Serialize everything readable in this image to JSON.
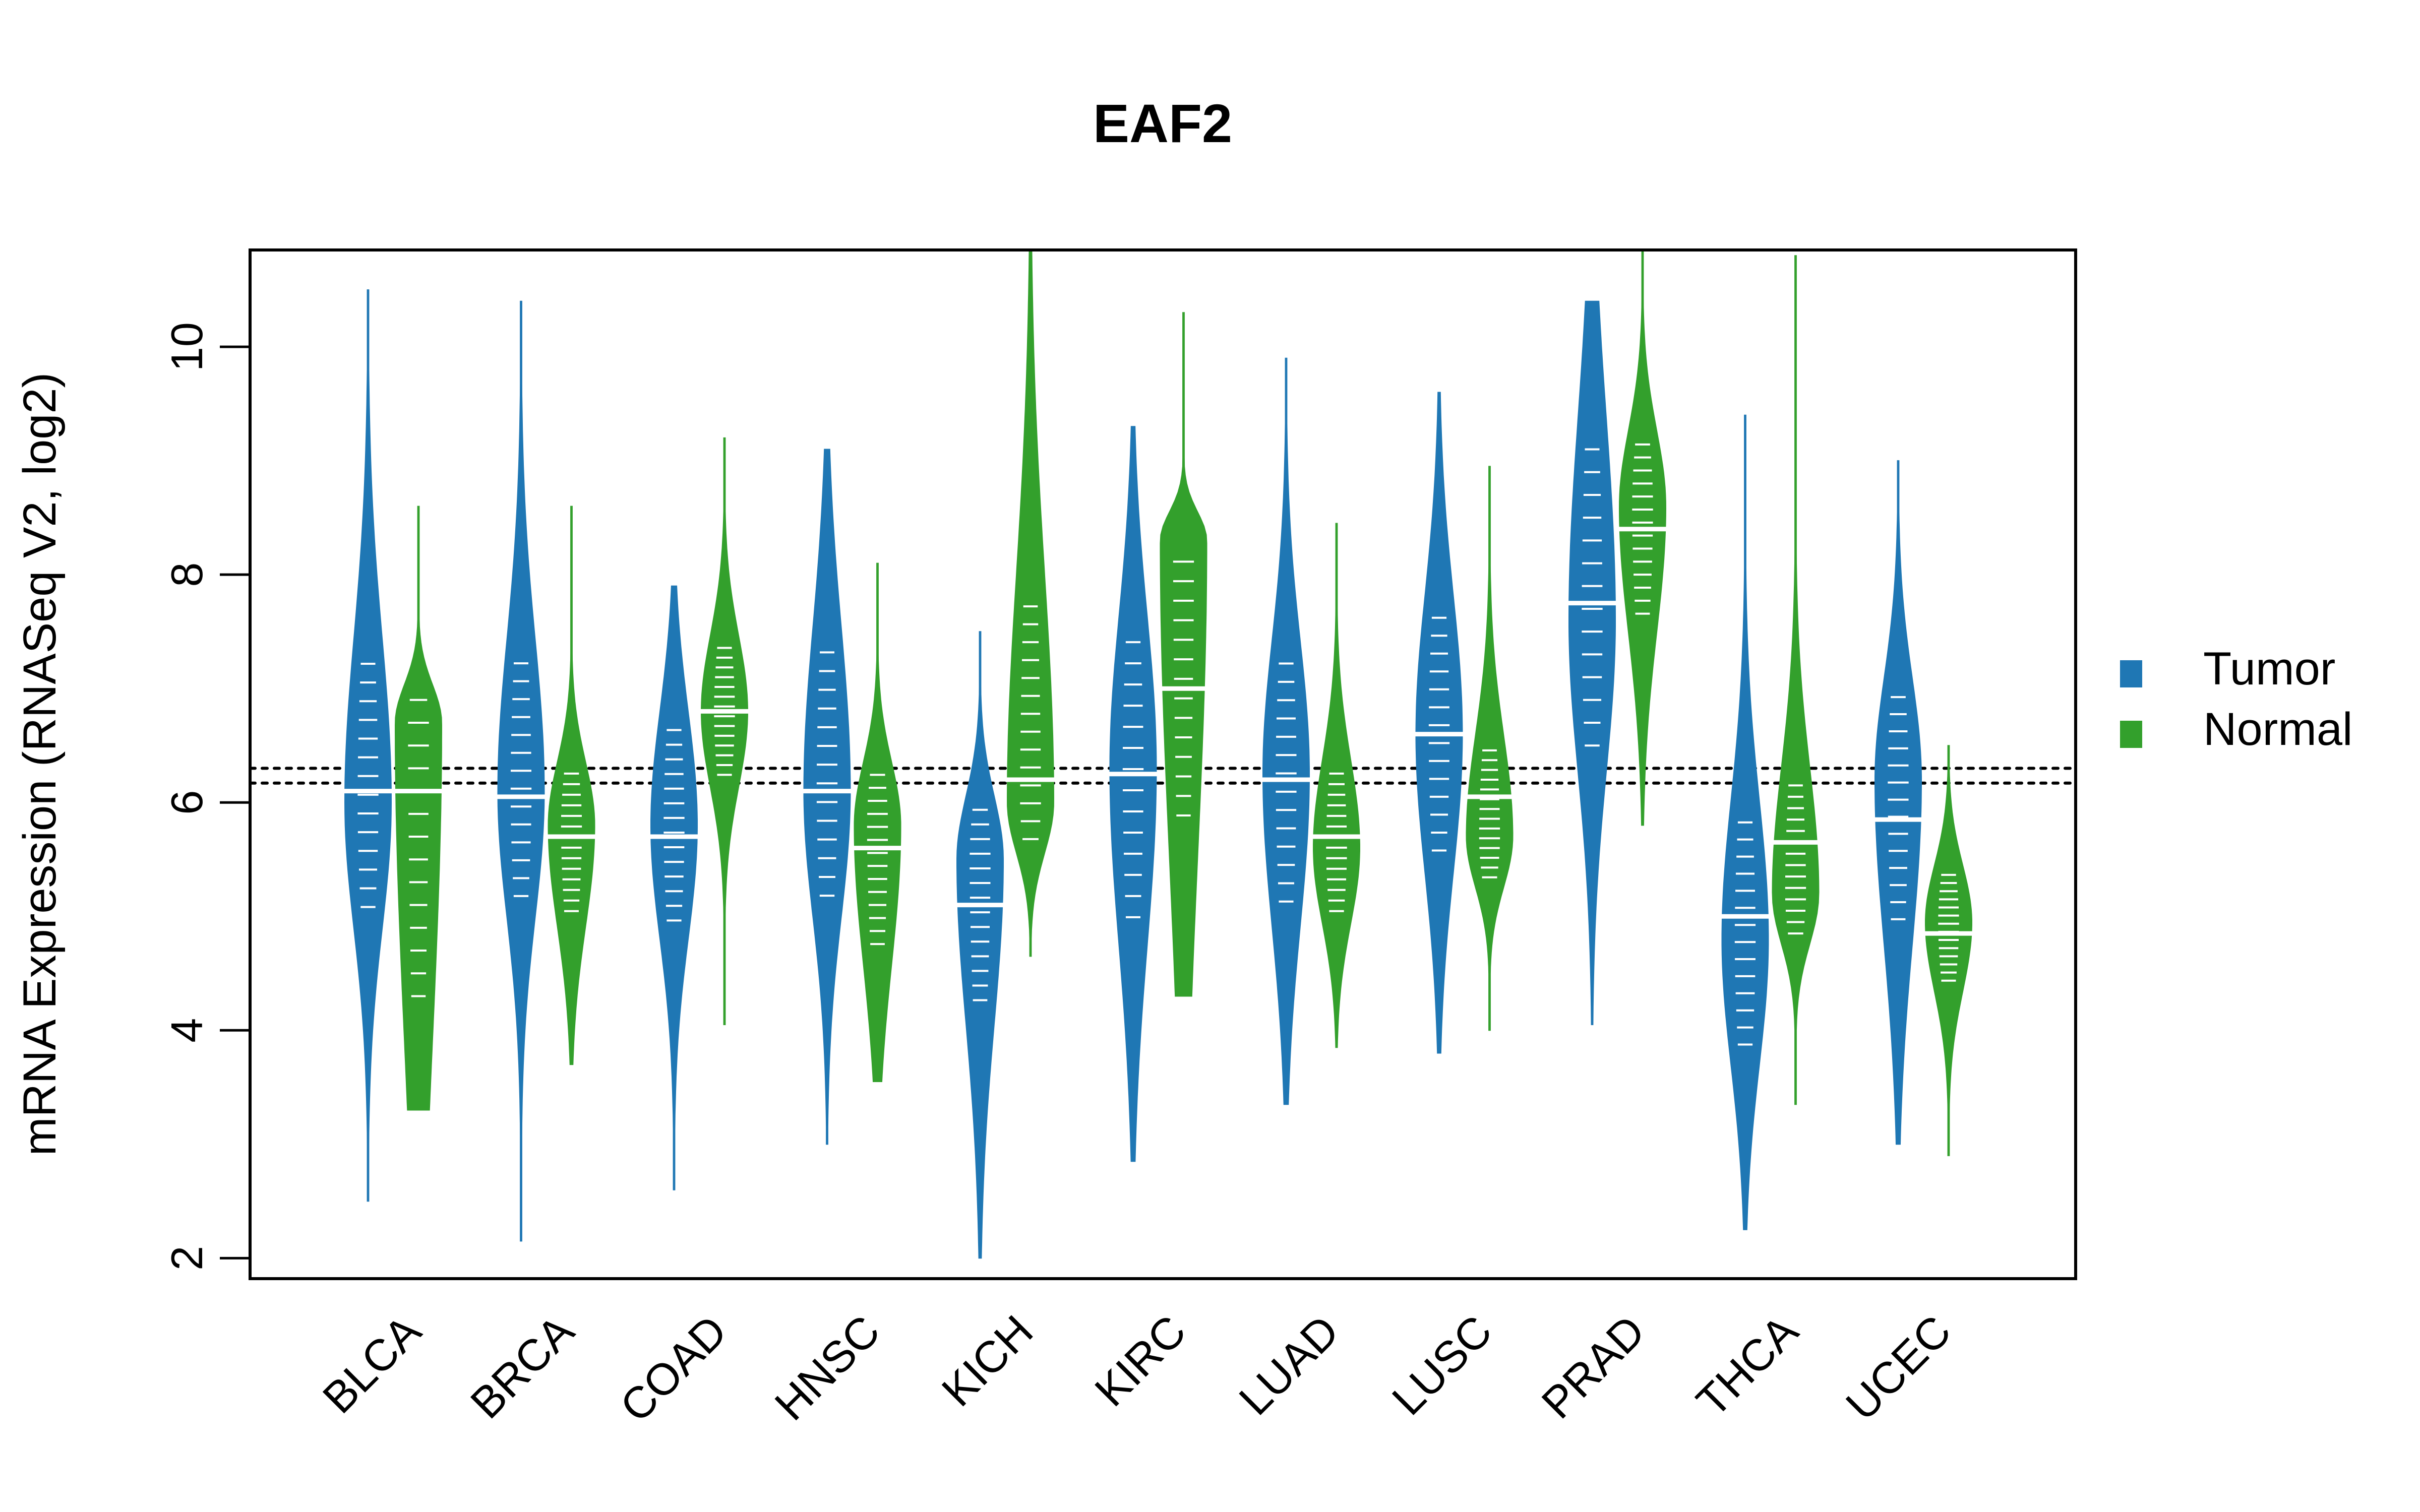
{
  "chart_data": {
    "type": "violin",
    "title": "EAF2",
    "xlabel": "",
    "ylabel": "mRNA Expression (RNASeq V2, log2)",
    "ylim": [
      1.82,
      10.85
    ],
    "yticks": [
      2,
      4,
      6,
      8,
      10
    ],
    "ytick_labels": [
      "2",
      "4",
      "6",
      "8",
      "10"
    ],
    "categories": [
      "BLCA",
      "BRCA",
      "COAD",
      "HNSC",
      "KICH",
      "KIRC",
      "LUAD",
      "LUSC",
      "PRAD",
      "THCA",
      "UCEC"
    ],
    "reference_lines": [
      6.3,
      6.17
    ],
    "reference_line_style": "dotted",
    "legend": {
      "position": "right",
      "entries": [
        {
          "label": "Tumor",
          "color": "#1f77b4"
        },
        {
          "label": "Normal",
          "color": "#33a02c"
        }
      ]
    },
    "series": [
      {
        "name": "Tumor",
        "color": "#1f77b4",
        "groups": [
          {
            "category": "BLCA",
            "min": 2.5,
            "max": 10.5,
            "median": 6.1,
            "q1": 5.0,
            "q3": 7.3,
            "peak": 6.0
          },
          {
            "category": "BRCA",
            "min": 2.15,
            "max": 10.4,
            "median": 6.05,
            "q1": 5.1,
            "q3": 7.3,
            "peak": 6.1
          },
          {
            "category": "COAD",
            "min": 2.6,
            "max": 7.9,
            "median": 5.7,
            "q1": 4.9,
            "q3": 6.7,
            "peak": 5.8
          },
          {
            "category": "HNSC",
            "min": 3.0,
            "max": 9.1,
            "median": 6.1,
            "q1": 5.1,
            "q3": 7.4,
            "peak": 6.1
          },
          {
            "category": "KICH",
            "min": 2.0,
            "max": 7.5,
            "median": 5.1,
            "q1": 4.2,
            "q3": 6.0,
            "peak": 5.5
          },
          {
            "category": "KIRC",
            "min": 2.85,
            "max": 9.3,
            "median": 6.25,
            "q1": 4.9,
            "q3": 7.5,
            "peak": 6.3
          },
          {
            "category": "LUAD",
            "min": 3.35,
            "max": 9.9,
            "median": 6.2,
            "q1": 5.05,
            "q3": 7.3,
            "peak": 6.25
          },
          {
            "category": "LUSC",
            "min": 3.8,
            "max": 9.6,
            "median": 6.6,
            "q1": 5.5,
            "q3": 7.7,
            "peak": 6.6
          },
          {
            "category": "PRAD",
            "min": 4.05,
            "max": 10.4,
            "median": 7.75,
            "q1": 6.4,
            "q3": 9.2,
            "peak": 7.6
          },
          {
            "category": "THCA",
            "min": 2.25,
            "max": 9.4,
            "median": 5.0,
            "q1": 3.8,
            "q3": 5.9,
            "peak": 4.8
          },
          {
            "category": "UCEC",
            "min": 3.0,
            "max": 9.0,
            "median": 5.85,
            "q1": 4.9,
            "q3": 7.0,
            "peak": 6.2
          }
        ]
      },
      {
        "name": "Normal",
        "color": "#33a02c",
        "groups": [
          {
            "category": "BLCA",
            "min": 3.3,
            "max": 8.6,
            "median": 6.1,
            "q1": 4.2,
            "q3": 7.0,
            "peak": 6.7
          },
          {
            "category": "BRCA",
            "min": 3.7,
            "max": 8.6,
            "median": 5.7,
            "q1": 5.0,
            "q3": 6.3,
            "peak": 5.8
          },
          {
            "category": "COAD",
            "min": 4.05,
            "max": 9.2,
            "median": 6.8,
            "q1": 6.2,
            "q3": 7.4,
            "peak": 6.8
          },
          {
            "category": "HNSC",
            "min": 3.55,
            "max": 8.1,
            "median": 5.6,
            "q1": 4.7,
            "q3": 6.3,
            "peak": 5.8
          },
          {
            "category": "KICH",
            "min": 4.65,
            "max": 10.85,
            "median": 6.2,
            "q1": 5.6,
            "q3": 7.8,
            "peak": 6.0
          },
          {
            "category": "KIRC",
            "min": 4.3,
            "max": 10.3,
            "median": 7.0,
            "q1": 5.8,
            "q3": 8.2,
            "peak": 8.3
          },
          {
            "category": "LUAD",
            "min": 3.85,
            "max": 8.45,
            "median": 5.7,
            "q1": 5.0,
            "q3": 6.3,
            "peak": 5.6
          },
          {
            "category": "LUSC",
            "min": 4.0,
            "max": 8.95,
            "median": 6.05,
            "q1": 5.3,
            "q3": 6.5,
            "peak": 5.7
          },
          {
            "category": "PRAD",
            "min": 5.8,
            "max": 10.85,
            "median": 8.4,
            "q1": 7.6,
            "q3": 9.2,
            "peak": 8.6
          },
          {
            "category": "THCA",
            "min": 3.35,
            "max": 10.8,
            "median": 5.65,
            "q1": 4.8,
            "q3": 6.2,
            "peak": 5.2
          },
          {
            "category": "UCEC",
            "min": 2.9,
            "max": 6.5,
            "median": 4.85,
            "q1": 4.4,
            "q3": 5.4,
            "peak": 4.95
          }
        ]
      }
    ]
  }
}
